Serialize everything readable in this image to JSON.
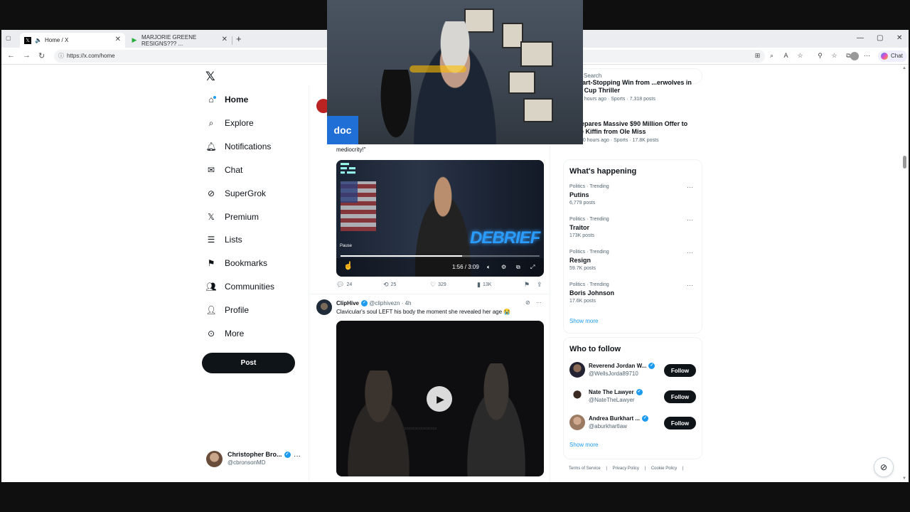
{
  "browser": {
    "tabs": [
      {
        "title": "Home / X",
        "active": true
      },
      {
        "title": "MARJORIE GREENE RESIGNS??? ...",
        "active": false
      }
    ],
    "url": "https://x.com/home",
    "copilot_label": "Chat"
  },
  "nav": {
    "items": [
      {
        "label": "Home",
        "icon": "home-icon"
      },
      {
        "label": "Explore",
        "icon": "search-icon"
      },
      {
        "label": "Notifications",
        "icon": "bell-icon"
      },
      {
        "label": "Chat",
        "icon": "mail-icon"
      },
      {
        "label": "SuperGrok",
        "icon": "grok-icon"
      },
      {
        "label": "Premium",
        "icon": "x-icon"
      },
      {
        "label": "Lists",
        "icon": "list-icon"
      },
      {
        "label": "Bookmarks",
        "icon": "bookmark-icon"
      },
      {
        "label": "Communities",
        "icon": "people-icon"
      },
      {
        "label": "Profile",
        "icon": "person-icon"
      },
      {
        "label": "More",
        "icon": "more-circle-icon"
      }
    ],
    "post_label": "Post"
  },
  "account": {
    "name": "Christopher Bro...",
    "handle": "@cbronsonMD"
  },
  "tweet1": {
    "text_tail": "mediocrity!\"",
    "video": {
      "time": "1:56 / 3:09",
      "status": "Pause",
      "overlay_text": "DEBRIEF",
      "progress": 0.61
    },
    "actions": {
      "replies": "24",
      "reposts": "25",
      "likes": "329",
      "views": "13K"
    }
  },
  "tweet2": {
    "name": "ClipHive",
    "handle": "@cliphivezn",
    "time": "4h",
    "text": "Clavicular's soul LEFT his body the moment she revealed her age 😭"
  },
  "sidebar": {
    "search_placeholder": "Search",
    "news": [
      {
        "title": "...Heart-Stopping Win from ...erwolves in NBA Cup Thriller",
        "meta": "4 hours ago · Sports · 7,318 posts"
      },
      {
        "title": "...Prepares Massive $90 Million Offer to Lane Kiffin from Ole Miss",
        "meta": "10 hours ago · Sports · 17.8K posts"
      }
    ],
    "happening": {
      "title": "What's happening",
      "trends": [
        {
          "category": "Politics · Trending",
          "name": "Putins",
          "count": "6,779 posts"
        },
        {
          "category": "Politics · Trending",
          "name": "Traitor",
          "count": "173K posts"
        },
        {
          "category": "Politics · Trending",
          "name": "Resign",
          "count": "59.7K posts"
        },
        {
          "category": "Politics · Trending",
          "name": "Boris Johnson",
          "count": "17.6K posts"
        }
      ],
      "show_more": "Show more"
    },
    "who_to_follow": {
      "title": "Who to follow",
      "accounts": [
        {
          "name": "Reverend Jordan W...",
          "handle": "@WellsJorda89710",
          "button": "Follow"
        },
        {
          "name": "Nate The Lawyer",
          "handle": "@NateTheLawyer",
          "button": "Follow"
        },
        {
          "name": "Andrea Burkhart ...",
          "handle": "@aburkhartlaw",
          "button": "Follow"
        }
      ],
      "show_more": "Show more"
    },
    "footer": [
      "Terms of Service",
      "|",
      "Privacy Policy",
      "|",
      "Cookie Policy",
      "|"
    ]
  },
  "webcam": {
    "badge": "doc"
  }
}
